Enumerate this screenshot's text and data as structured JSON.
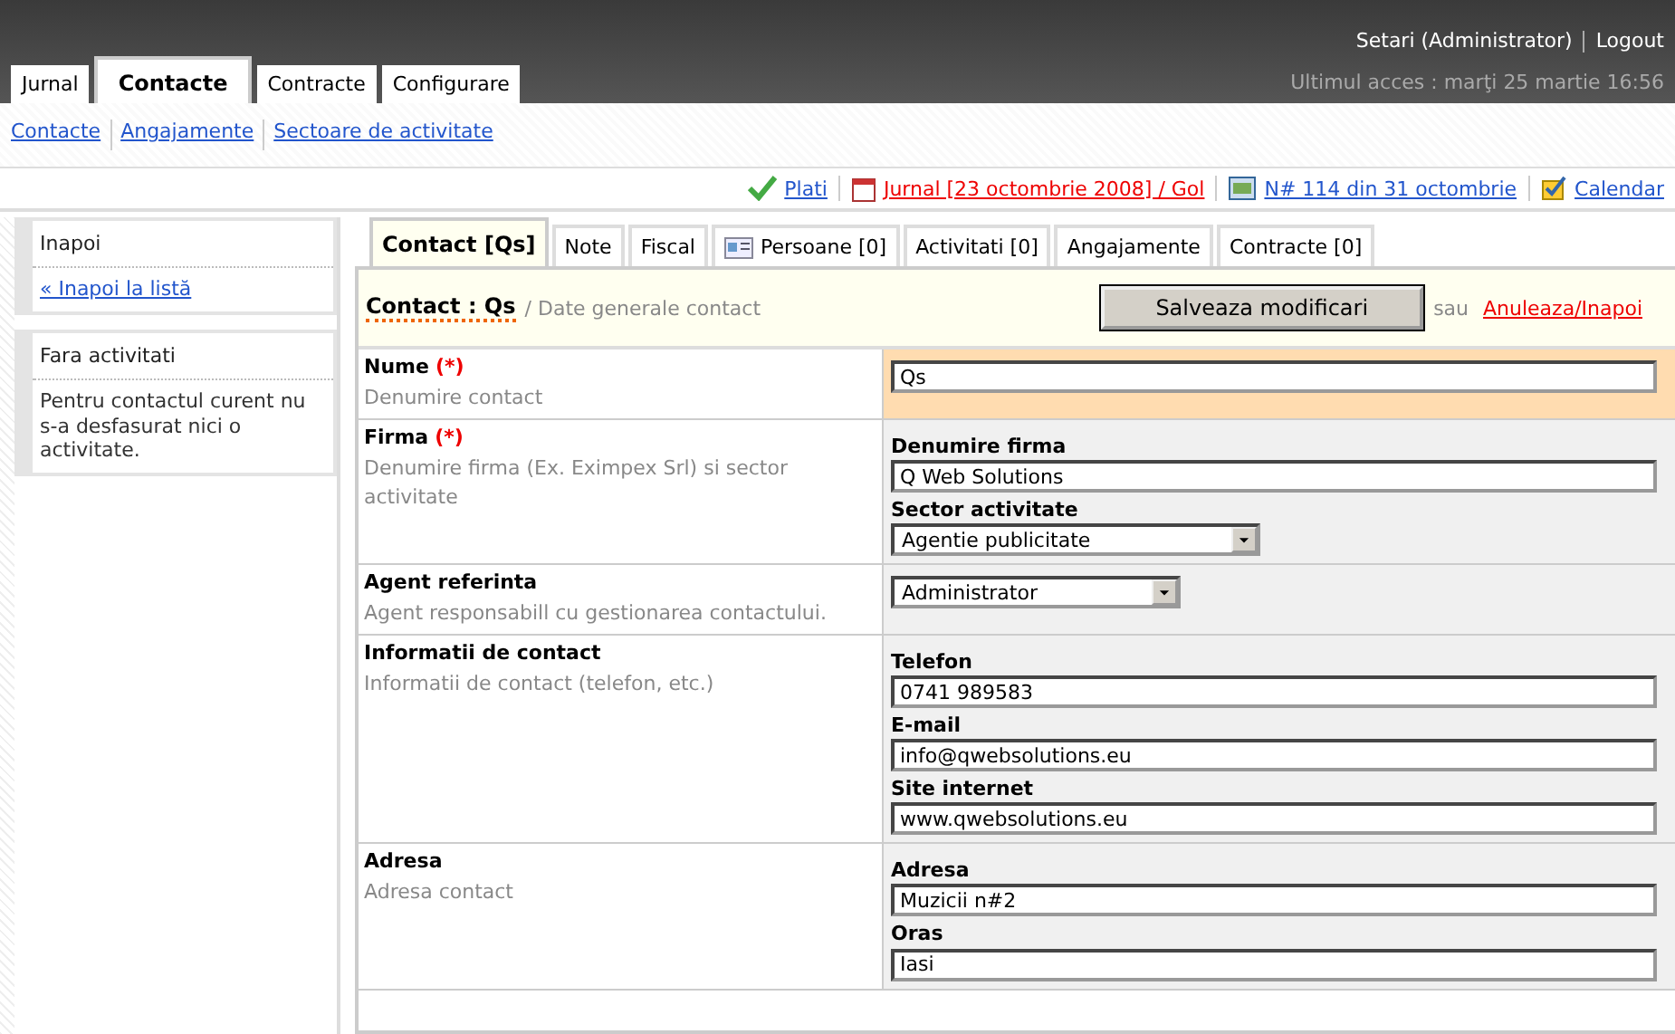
{
  "header": {
    "user_link": "Setari (Administrator)",
    "logout": "Logout",
    "last_access": "Ultimul acces : marţi 25 martie 16:56"
  },
  "main_tabs": [
    {
      "label": "Jurnal",
      "selected": false
    },
    {
      "label": "Contacte",
      "selected": true
    },
    {
      "label": "Contracte",
      "selected": false
    },
    {
      "label": "Configurare",
      "selected": false
    }
  ],
  "sub_nav": [
    "Contacte",
    "Angajamente",
    "Sectoare de activitate"
  ],
  "toolbar": [
    {
      "kind": "check",
      "label": "Plati",
      "alert": false
    },
    {
      "kind": "calendar",
      "label": "Jurnal [23 octombrie 2008] / Gol",
      "alert": true
    },
    {
      "kind": "card",
      "label": "N# 114 din 31 octombrie",
      "alert": false
    },
    {
      "kind": "task",
      "label": "Calendar",
      "alert": false
    }
  ],
  "sidebar": [
    {
      "title": "Inapoi",
      "link": "« Inapoi la listă"
    },
    {
      "title": "Fara activitati",
      "text": "Pentru contactul curent nu s-a desfasurat nici o activitate."
    }
  ],
  "content_tabs": [
    {
      "label": "Contact [Qs]",
      "selected": true
    },
    {
      "label": "Note",
      "selected": false
    },
    {
      "label": "Fiscal",
      "selected": false
    },
    {
      "label": "Persoane [0]",
      "selected": false,
      "icon": true
    },
    {
      "label": "Activitati [0]",
      "selected": false
    },
    {
      "label": "Angajamente",
      "selected": false
    },
    {
      "label": "Contracte [0]",
      "selected": false
    }
  ],
  "form_header": {
    "title": "Contact : Qs",
    "subtitle": "/ Date generale contact",
    "save": "Salveaza modificari",
    "or": "sau",
    "cancel": "Anuleaza/Inapoi"
  },
  "rows": [
    {
      "label": "Nume",
      "required": "(*)",
      "hint": "Denumire contact",
      "highlighted": true,
      "fields": [
        {
          "kind": "text",
          "value": "Qs"
        }
      ]
    },
    {
      "label": "Firma",
      "required": "(*)",
      "hint": "Denumire firma (Ex. Eximpex Srl) si sector activitate",
      "highlighted": false,
      "fields": [
        {
          "kind": "text",
          "label": "Denumire firma",
          "value": "Q Web Solutions"
        },
        {
          "kind": "select",
          "label": "Sector activitate",
          "value": "Agentie publicitate"
        }
      ]
    },
    {
      "label": "Agent referinta",
      "hint": "Agent responsabill cu gestionarea contactului.",
      "highlighted": false,
      "fields": [
        {
          "kind": "select",
          "value": "Administrator",
          "short": true
        }
      ]
    },
    {
      "label": "Informatii de contact",
      "hint": "Informatii de contact (telefon, etc.)",
      "highlighted": false,
      "fields": [
        {
          "kind": "text",
          "label": "Telefon",
          "value": "0741 989583"
        },
        {
          "kind": "text",
          "label": "E-mail",
          "value": "info@qwebsolutions.eu"
        },
        {
          "kind": "text",
          "label": "Site internet",
          "value": "www.qwebsolutions.eu"
        }
      ]
    },
    {
      "label": "Adresa",
      "hint": "Adresa contact",
      "highlighted": false,
      "fields": [
        {
          "kind": "text",
          "label": "Adresa",
          "value": "Muzicii n#2"
        },
        {
          "kind": "text",
          "label": "Oras",
          "value": "Iasi"
        }
      ]
    }
  ]
}
